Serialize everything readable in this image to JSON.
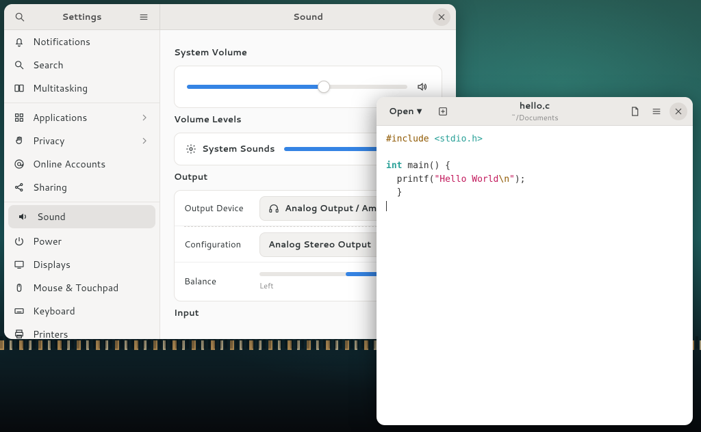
{
  "settings": {
    "sidebar_title": "Settings",
    "page_title": "Sound",
    "sidebar_items": [
      {
        "id": "notifications",
        "icon": "bell",
        "label": "Notifications"
      },
      {
        "id": "search",
        "icon": "search",
        "label": "Search"
      },
      {
        "id": "multitasking",
        "icon": "multitask",
        "label": "Multitasking"
      },
      {
        "id": "sep"
      },
      {
        "id": "applications",
        "icon": "grid",
        "label": "Applications",
        "chevron": true
      },
      {
        "id": "privacy",
        "icon": "hand",
        "label": "Privacy",
        "chevron": true
      },
      {
        "id": "online",
        "icon": "at",
        "label": "Online Accounts"
      },
      {
        "id": "sharing",
        "icon": "share",
        "label": "Sharing"
      },
      {
        "id": "sep"
      },
      {
        "id": "sound",
        "icon": "speaker",
        "label": "Sound",
        "active": true
      },
      {
        "id": "power",
        "icon": "power",
        "label": "Power"
      },
      {
        "id": "displays",
        "icon": "display",
        "label": "Displays"
      },
      {
        "id": "mouse",
        "icon": "mouse",
        "label": "Mouse & Touchpad"
      },
      {
        "id": "keyboard",
        "icon": "keyboard",
        "label": "Keyboard"
      },
      {
        "id": "printers",
        "icon": "printer",
        "label": "Printers"
      }
    ],
    "sound": {
      "section_volume": "System Volume",
      "volume_percent": 62,
      "section_levels": "Volume Levels",
      "levels": [
        {
          "name": "System Sounds",
          "percent": 100
        }
      ],
      "section_output": "Output",
      "output_device_label": "Output Device",
      "output_device_value": "Analog Output / Amplifier - ..",
      "configuration_label": "Configuration",
      "configuration_value": "Analog Stereo Output",
      "balance_label": "Balance",
      "balance_percent": 77,
      "balance_left": "Left",
      "section_input": "Input"
    }
  },
  "editor": {
    "open_label": "Open",
    "file_name": "hello.c",
    "file_path": "~/Documents",
    "code": {
      "l1_pp": "#include ",
      "l1_inc": "<stdio.h>",
      "l2_kw": "int",
      "l2_rest": " main() {",
      "l3_a": "  printf(",
      "l3_q1": "\"",
      "l3_str": "Hello World",
      "l3_esc": "\\n",
      "l3_q2": "\"",
      "l3_b": ");",
      "l4": "  }"
    }
  }
}
